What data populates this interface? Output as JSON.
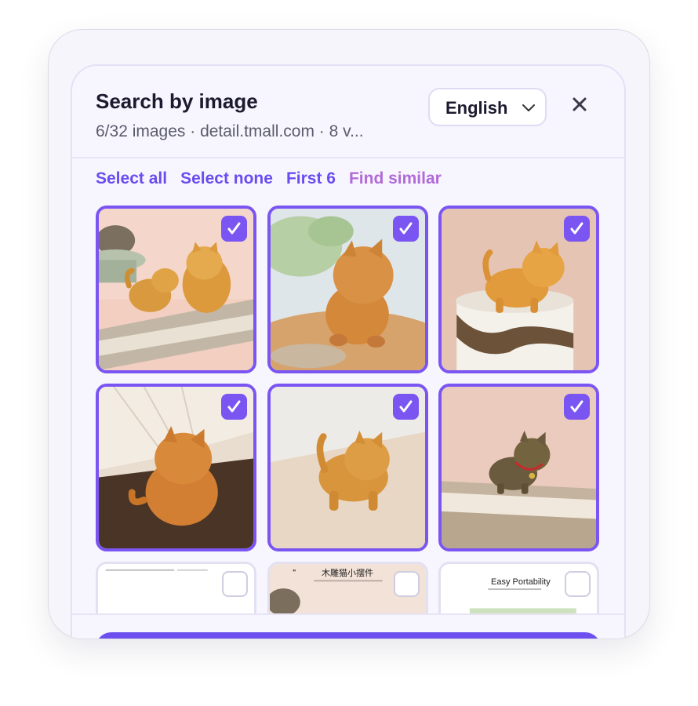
{
  "header": {
    "title": "Search by image",
    "subtitle": "6/32 images · detail.tmall.com · 8 v...",
    "language": "English",
    "close_icon": "close-icon"
  },
  "actions": {
    "select_all": "Select all",
    "select_none": "Select none",
    "first_n": "First 6",
    "find_similar": "Find similar"
  },
  "tiles": [
    {
      "id": "img-1",
      "selected": true
    },
    {
      "id": "img-2",
      "selected": true
    },
    {
      "id": "img-3",
      "selected": true
    },
    {
      "id": "img-4",
      "selected": true
    },
    {
      "id": "img-5",
      "selected": true
    },
    {
      "id": "img-6",
      "selected": true
    },
    {
      "id": "img-7",
      "selected": false
    },
    {
      "id": "img-8",
      "selected": false,
      "caption": "木雕猫小摆件"
    },
    {
      "id": "img-9",
      "selected": false,
      "caption": "Easy Portability"
    }
  ],
  "colors": {
    "accent": "#7a55f2",
    "link": "#6a4cf0",
    "link_secondary": "#b26ad8"
  }
}
